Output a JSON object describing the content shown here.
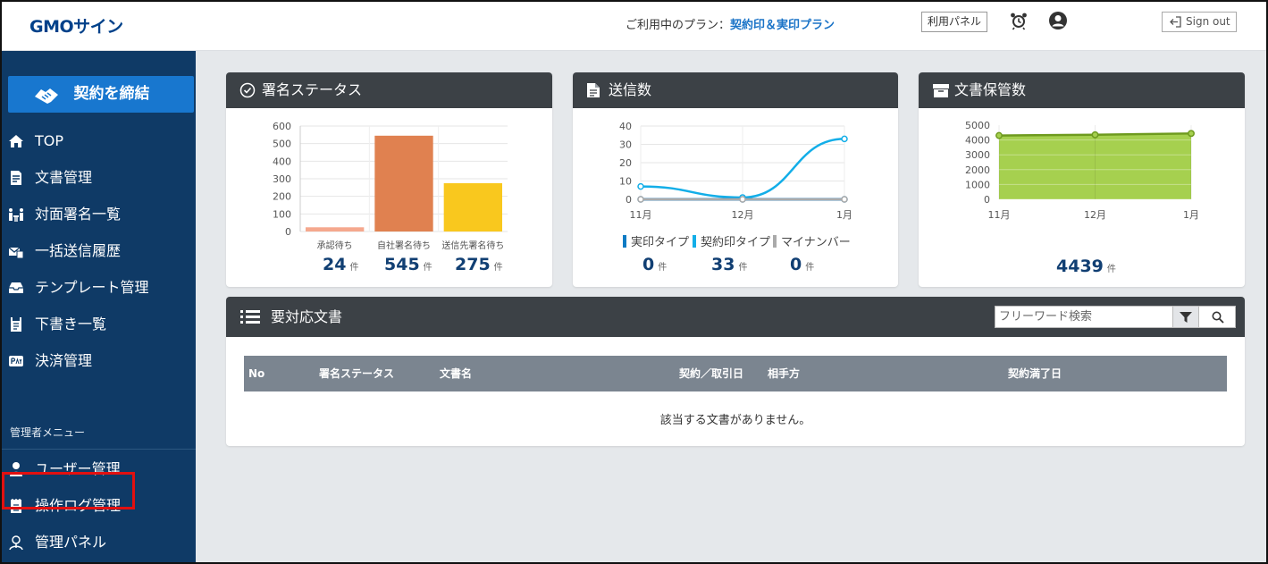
{
  "header": {
    "logo": "GMOサイン",
    "plan_prefix": "ご利用中のプラン：",
    "plan_name": "契約印＆実印プラン",
    "panel_button": "利用パネル",
    "sign_out": "Sign out"
  },
  "sidebar": {
    "cta": "契約を締結",
    "items": [
      {
        "label": "TOP",
        "icon": "home-icon"
      },
      {
        "label": "文書管理",
        "icon": "document-icon"
      },
      {
        "label": "対面署名一覧",
        "icon": "face-to-face-icon"
      },
      {
        "label": "一括送信履歴",
        "icon": "bulk-send-icon"
      },
      {
        "label": "テンプレート管理",
        "icon": "template-icon"
      },
      {
        "label": "下書き一覧",
        "icon": "draft-icon"
      },
      {
        "label": "決済管理",
        "icon": "pay-icon"
      }
    ],
    "admin_label": "管理者メニュー",
    "admin_items": [
      {
        "label": "ユーザー管理",
        "icon": "user-icon"
      },
      {
        "label": "操作ログ管理",
        "icon": "log-icon"
      },
      {
        "label": "管理パネル",
        "icon": "admin-panel-icon"
      }
    ]
  },
  "cards": {
    "status": {
      "title": "署名ステータス"
    },
    "sent": {
      "title": "送信数"
    },
    "storage": {
      "title": "文書保管数"
    }
  },
  "chart_data": [
    {
      "type": "bar",
      "title": "署名ステータス",
      "categories": [
        "承認待ち",
        "自社署名待ち",
        "送信先署名待ち"
      ],
      "values": [
        24,
        545,
        275
      ],
      "ylim": [
        0,
        600
      ],
      "yticks": [
        0,
        100,
        200,
        300,
        400,
        500,
        600
      ],
      "colors": [
        "#f5a88e",
        "#e08150",
        "#f9c81e"
      ],
      "unit": "件",
      "grid": true
    },
    {
      "type": "line",
      "title": "送信数",
      "categories": [
        "11月",
        "12月",
        "1月"
      ],
      "series": [
        {
          "name": "実印タイプ",
          "values": [
            0,
            0,
            0
          ],
          "total": 0,
          "color": "#0f7bc4"
        },
        {
          "name": "契約印タイプ",
          "values": [
            7,
            1,
            33
          ],
          "total": 33,
          "color": "#13aee8"
        },
        {
          "name": "マイナンバー",
          "values": [
            0,
            0,
            0
          ],
          "total": 0,
          "color": "#aaaaaa"
        }
      ],
      "ylim": [
        0,
        40
      ],
      "yticks": [
        0,
        10,
        20,
        30,
        40
      ],
      "unit": "件",
      "grid": true,
      "legend": "bottom"
    },
    {
      "type": "area",
      "title": "文書保管数",
      "categories": [
        "11月",
        "12月",
        "1月"
      ],
      "values": [
        4300,
        4350,
        4439
      ],
      "ylim": [
        0,
        5000
      ],
      "yticks": [
        0,
        1000,
        2000,
        3000,
        4000,
        5000
      ],
      "total": 4439,
      "unit": "件",
      "color": "#a6d04f",
      "grid": true
    }
  ],
  "documents": {
    "title": "要対応文書",
    "search_placeholder": "フリーワード検索",
    "columns": [
      "No",
      "署名ステータス",
      "文書名",
      "契約／取引日",
      "相手方",
      "契約満了日"
    ],
    "empty_message": "該当する文書がありません。"
  }
}
